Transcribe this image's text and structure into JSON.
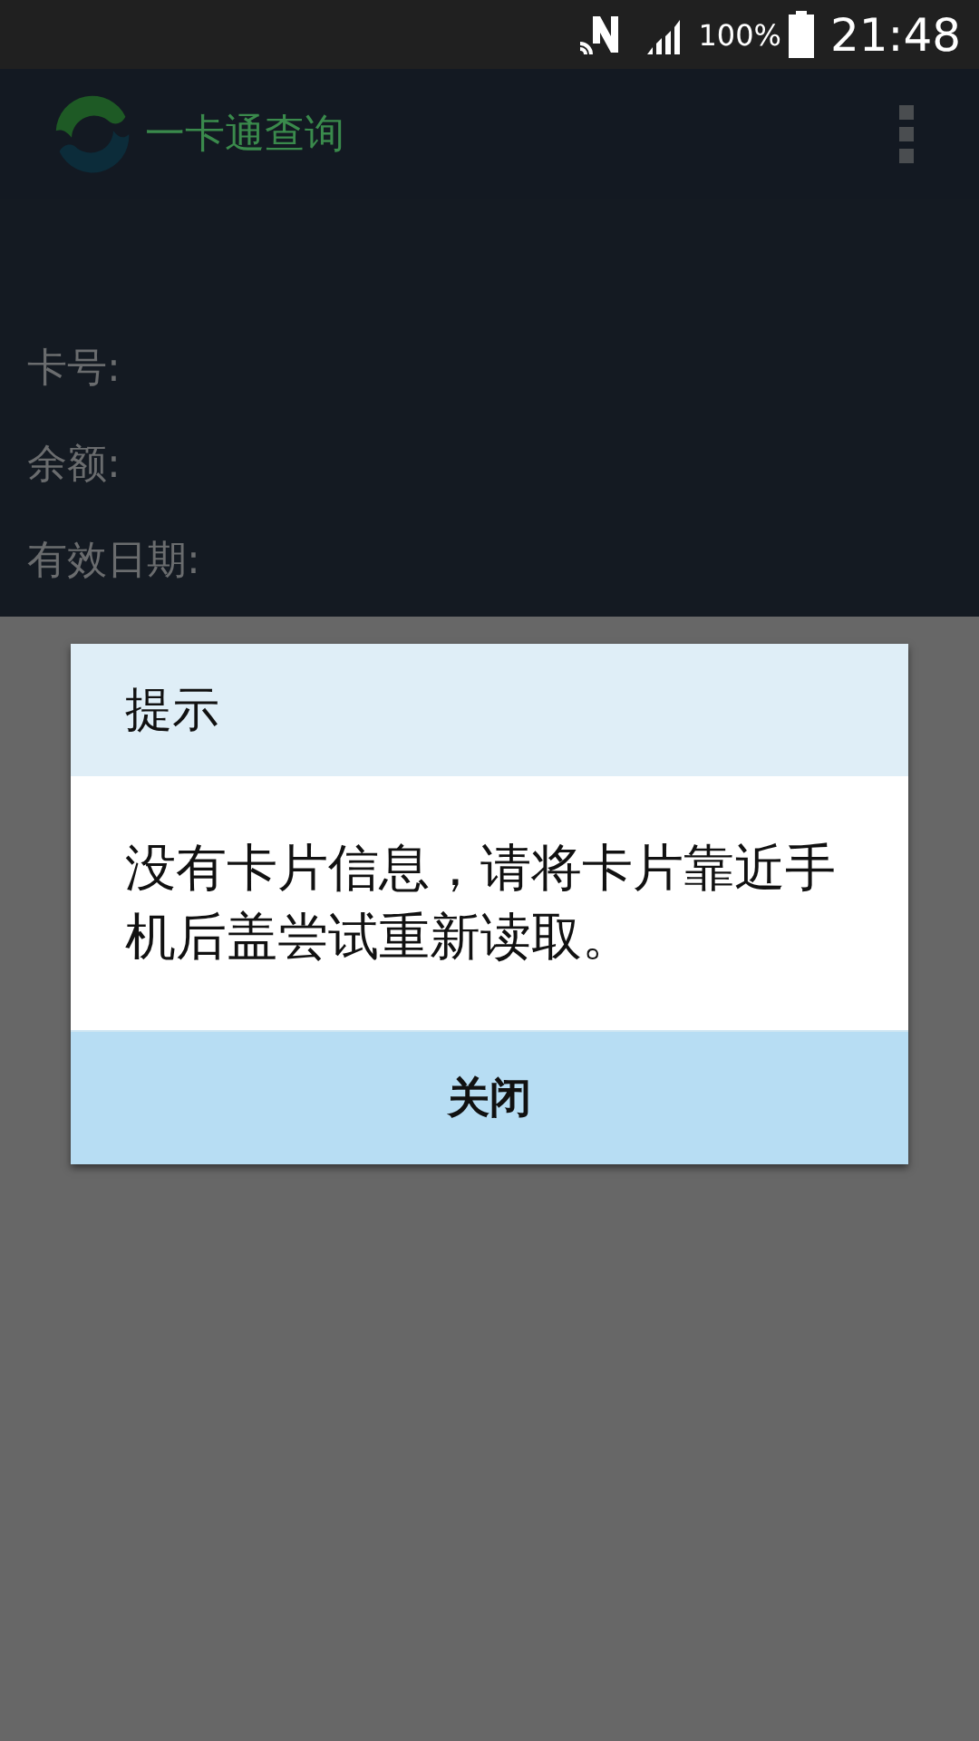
{
  "status_bar": {
    "battery": "100%",
    "time": "21:48"
  },
  "app_bar": {
    "title": "一卡通查询"
  },
  "fields": [
    {
      "label": "卡号:"
    },
    {
      "label": "余额:"
    },
    {
      "label": "有效日期:"
    }
  ],
  "dialog": {
    "title": "提示",
    "message": "没有卡片信息，请将卡片靠近手机后盖尝试重新读取。",
    "buttons": [
      "关闭"
    ]
  }
}
